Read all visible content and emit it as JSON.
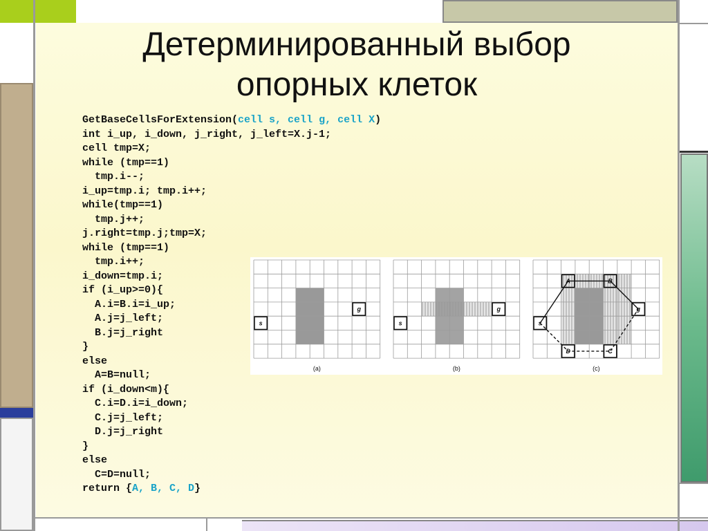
{
  "title_line1": "Детерминированный выбор",
  "title_line2": "опорных клеток",
  "code": {
    "l1_pre": "GetBaseCellsForExtension(",
    "l1_args": "cell s, cell g, cell X",
    "l1_post": ")",
    "lines": [
      "int i_up, i_down, j_right, j_left=X.j-1;",
      "cell tmp=X;",
      "while (tmp==1)",
      "  tmp.i--;",
      "i_up=tmp.i; tmp.i++;",
      "while(tmp==1)",
      "  tmp.j++;",
      "j.right=tmp.j;tmp=X;",
      "while (tmp==1)",
      "  tmp.i++;",
      "i_down=tmp.i;",
      "if (i_up>=0){",
      "  A.i=B.i=i_up;",
      "  A.j=j_left;",
      "  B.j=j_right",
      "}",
      "else",
      "  A=B=null;",
      "if (i_down<m){",
      "  C.i=D.i=i_down;",
      "  C.j=j_left;",
      "  D.j=j_right",
      "}",
      "else",
      "  C=D=null;"
    ],
    "last_pre": "return {",
    "last_vars": "A, B, C, D",
    "last_post": "}"
  },
  "figure": {
    "panel_labels": [
      "(a)",
      "(b)",
      "(c)"
    ],
    "cell_labels": {
      "s": "s",
      "g": "g",
      "A": "A",
      "B": "B",
      "C": "C",
      "D": "D"
    }
  },
  "colors": {
    "green_accent": "#a9cf1c",
    "tan_bar": "#c0ae8e",
    "navy_bar": "#2a3e9c",
    "olive_bar": "#c7c8a8",
    "sea_green": "#3f9b6c",
    "lavender": "#d6c8ee",
    "code_highlight": "#1aa3c8"
  }
}
